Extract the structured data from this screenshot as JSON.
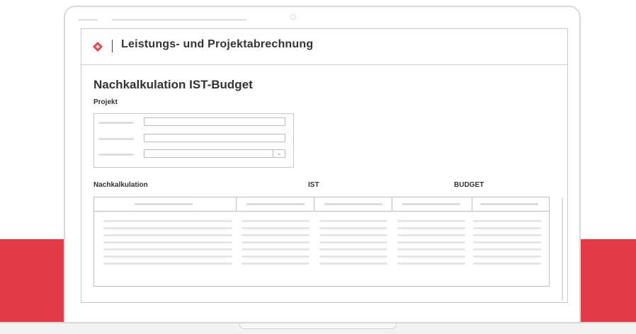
{
  "app": {
    "title": "Leistungs- und Projektabrechnung"
  },
  "page": {
    "title": "Nachkalkulation IST-Budget"
  },
  "project": {
    "section_label": "Projekt"
  },
  "table": {
    "section_label": "Nachkalkulation",
    "ist_label": "IST",
    "budget_label": "BUDGET"
  },
  "colors": {
    "accent": "#e23a46",
    "text": "#333333",
    "border": "#c9c9c9"
  },
  "icons": {
    "logo": "diamond-logo-icon",
    "select": "chevron-down-icon"
  }
}
